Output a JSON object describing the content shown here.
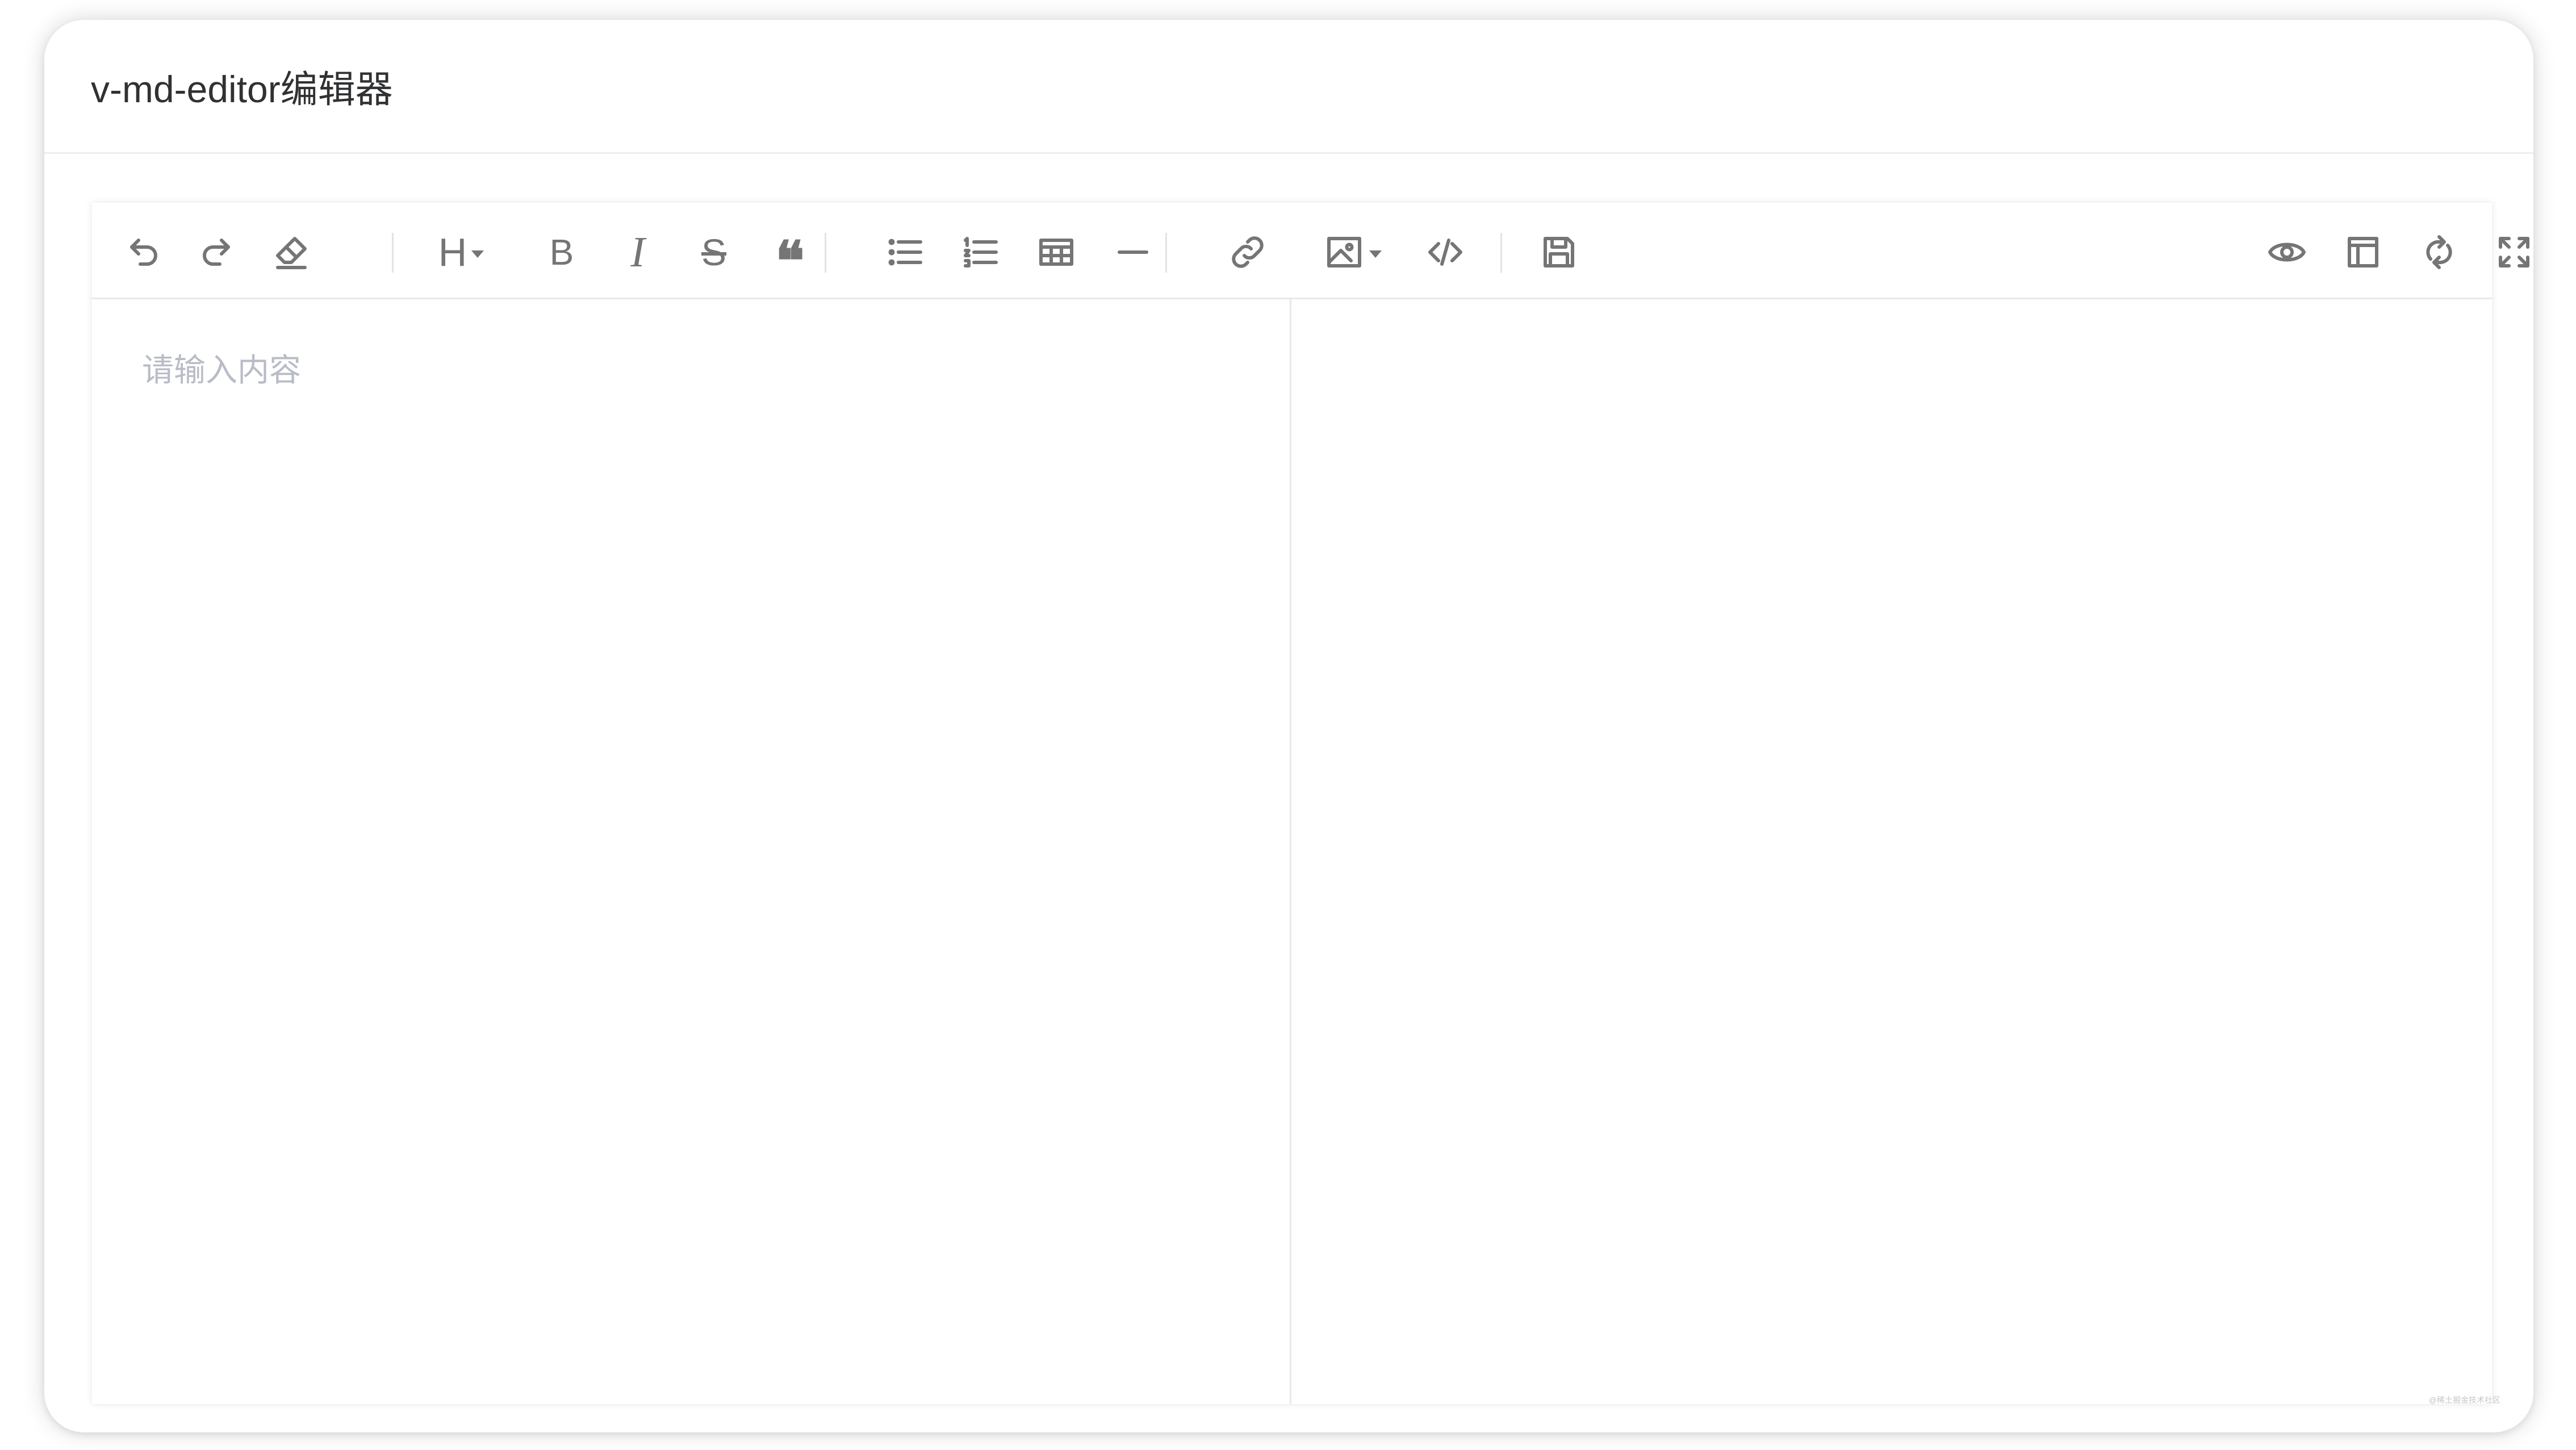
{
  "card": {
    "title": "v-md-editor编辑器"
  },
  "editor": {
    "placeholder": "请输入内容",
    "toolbar_left": [
      {
        "name": "undo-button",
        "icon": "undo-icon"
      },
      {
        "name": "redo-button",
        "icon": "redo-icon"
      },
      {
        "name": "clear-button",
        "icon": "eraser-icon"
      },
      {
        "name": "heading-button",
        "icon": "heading-icon",
        "glyph": "H"
      },
      {
        "name": "bold-button",
        "icon": "bold-icon",
        "glyph": "B"
      },
      {
        "name": "italic-button",
        "icon": "italic-icon",
        "glyph": "I"
      },
      {
        "name": "strikethrough-button",
        "icon": "strikethrough-icon",
        "glyph": "S"
      },
      {
        "name": "quote-button",
        "icon": "quote-icon",
        "glyph": "❝"
      },
      {
        "name": "unordered-list-button",
        "icon": "unordered-list-icon"
      },
      {
        "name": "ordered-list-button",
        "icon": "ordered-list-icon"
      },
      {
        "name": "table-button",
        "icon": "table-icon"
      },
      {
        "name": "horizontal-rule-button",
        "icon": "hr-icon"
      },
      {
        "name": "link-button",
        "icon": "link-icon"
      },
      {
        "name": "image-button",
        "icon": "image-icon"
      },
      {
        "name": "code-button",
        "icon": "code-icon"
      },
      {
        "name": "save-button",
        "icon": "save-icon"
      }
    ],
    "toolbar_right": [
      {
        "name": "preview-toggle-button",
        "icon": "eye-icon"
      },
      {
        "name": "toc-button",
        "icon": "layout-icon"
      },
      {
        "name": "sync-scroll-button",
        "icon": "sync-icon"
      },
      {
        "name": "fullscreen-button",
        "icon": "fullscreen-icon"
      }
    ]
  },
  "watermark": "@稀土掘金技术社区",
  "colors": {
    "icon": "#757575",
    "placeholder": "#b8bcc6",
    "title": "#303133",
    "border": "#e8e8e8"
  }
}
